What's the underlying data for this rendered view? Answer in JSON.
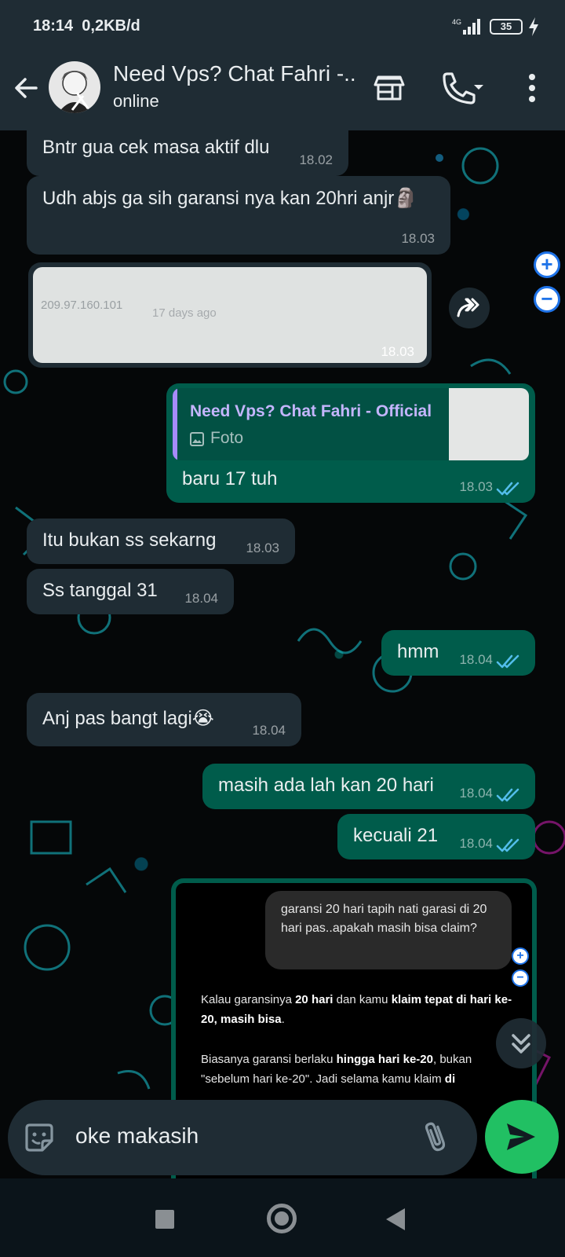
{
  "status_bar": {
    "time": "18:14",
    "speed": "0,2KB/d",
    "network": "4G",
    "battery": "35"
  },
  "header": {
    "contact_name": "Need Vps? Chat Fahri -...",
    "status": "online",
    "icons": [
      "back-arrow-icon",
      "store-icon",
      "call-icon",
      "more-vert-icon"
    ]
  },
  "messages": [
    {
      "dir": "in",
      "text": "Bntr gua cek masa aktif dlu",
      "time": "18.02"
    },
    {
      "dir": "in",
      "text": "Udh abjs ga sih garansi nya kan 20hri anjr🗿",
      "time": "18.03"
    },
    {
      "dir": "in",
      "type": "image",
      "image_text_1": "209.97.160.101",
      "image_text_2": "17 days ago",
      "time": "18.03"
    },
    {
      "dir": "out",
      "reply_to": "Need Vps? Chat Fahri - Official",
      "reply_type": "Foto",
      "text": "baru 17 tuh",
      "time": "18.03"
    },
    {
      "dir": "in",
      "text": "Itu bukan ss sekarng",
      "time": "18.03"
    },
    {
      "dir": "in",
      "text": "Ss tanggal 31",
      "time": "18.04"
    },
    {
      "dir": "out",
      "text": "hmm",
      "time": "18.04"
    },
    {
      "dir": "in",
      "text": "Anj pas bangt lagi😭",
      "time": "18.04"
    },
    {
      "dir": "out",
      "text": "masih ada lah kan 20 hari",
      "time": "18.04"
    },
    {
      "dir": "out",
      "text": "kecuali 21",
      "time": "18.04"
    }
  ],
  "screenshot_msg": {
    "question": "garansi 20 hari tapih nati garasi di 20 hari pas..apakah masih bisa claim?",
    "ans1_a": "Kalau garansinya ",
    "ans1_b": "20 hari",
    "ans1_c": " dan kamu ",
    "ans1_d": "klaim tepat di hari ke-20, masih bisa",
    "ans1_e": ".",
    "ans2_a": "Biasanya garansi berlaku ",
    "ans2_b": "hingga hari ke-20",
    "ans2_c": ", bukan \"sebelum hari ke-20\". Jadi selama kamu klaim ",
    "ans2_d": "di"
  },
  "zoom": {
    "in": "+",
    "out": "−"
  },
  "input": {
    "value": "oke makasih"
  },
  "colors": {
    "incoming": "#1f2c34",
    "outgoing": "#005c4b",
    "send": "#21c063",
    "read_ticks": "#53bdeb"
  }
}
